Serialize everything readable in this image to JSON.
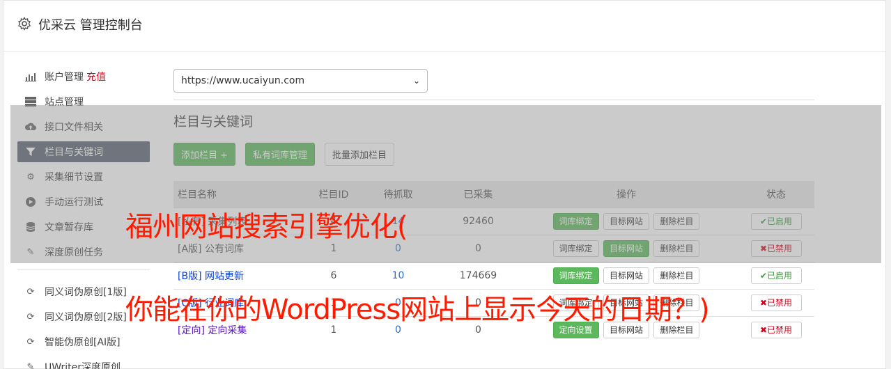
{
  "header": {
    "title": "优采云 管理控制台"
  },
  "sidebar": {
    "items": [
      {
        "icon": "bar-chart-icon",
        "label": "账户管理",
        "extra": "充值"
      },
      {
        "icon": "server-icon",
        "label": "站点管理"
      },
      {
        "icon": "cloud-upload-icon",
        "label": "接口文件相关"
      },
      {
        "icon": "filter-icon",
        "label": "栏目与关键词"
      },
      {
        "icon": "cogs-icon",
        "label": "采集细节设置"
      },
      {
        "icon": "play-circle-icon",
        "label": "手动运行测试"
      },
      {
        "icon": "database-icon",
        "label": "文章暂存库"
      },
      {
        "icon": "edit-icon",
        "label": "深度原创任务"
      }
    ],
    "tools": [
      {
        "icon": "refresh-icon",
        "label": "同义词伪原创[1版]"
      },
      {
        "icon": "refresh-icon",
        "label": "同义词伪原创[2版]"
      },
      {
        "icon": "refresh-icon",
        "label": "智能伪原创[AI版]"
      },
      {
        "icon": "edit-icon",
        "label": "UWriter深度原创"
      }
    ]
  },
  "site_select": {
    "value": "https://www.ucaiyun.com"
  },
  "section": {
    "title": "栏目与关键词"
  },
  "buttons": {
    "add": "添加栏目 +",
    "private": "私有词库管理",
    "batch": "批量添加栏目"
  },
  "table": {
    "headers": [
      "栏目名称",
      "栏目ID",
      "待抓取",
      "已采集",
      "操作",
      "状态"
    ],
    "rows": [
      {
        "name": "[私有] 采集列表",
        "id": "4",
        "pending": "14",
        "collected": "92460",
        "bind": "词库绑定",
        "target": "目标网站",
        "delete": "删除栏目",
        "status": "已启用"
      },
      {
        "name": "[A版] 公有词库",
        "id": "1",
        "pending": "0",
        "collected": "0",
        "bind": "词库绑定",
        "target": "目标网站",
        "delete": "删除栏目",
        "status": "已禁用"
      },
      {
        "name": "[B版] 网站更新",
        "id": "6",
        "pending": "10",
        "collected": "174669",
        "bind": "词库绑定",
        "target": "目标网站",
        "delete": "删除栏目",
        "status": "已启用"
      },
      {
        "name": "[C版] 行业词库",
        "id": "1",
        "pending": "0",
        "collected": "0",
        "bind": "词库绑定",
        "target": "目标网站",
        "delete": "删除栏目",
        "status": "已禁用"
      },
      {
        "name": "[定向] 定向采集",
        "id": "1",
        "pending": "0",
        "collected": "0",
        "bind": "定向设置",
        "target": "目标网站",
        "delete": "删除栏目",
        "status": "已禁用"
      }
    ]
  },
  "watermark": {
    "line1": "福州网站搜索引擎优化(",
    "line2": "你能在你的WordPress网站上显示今天的日期？)"
  },
  "colors": {
    "accent_green": "#5cb85c",
    "sidebar_active": "#5a6270",
    "danger": "#d9001b",
    "watermark": "#ff1a00"
  }
}
